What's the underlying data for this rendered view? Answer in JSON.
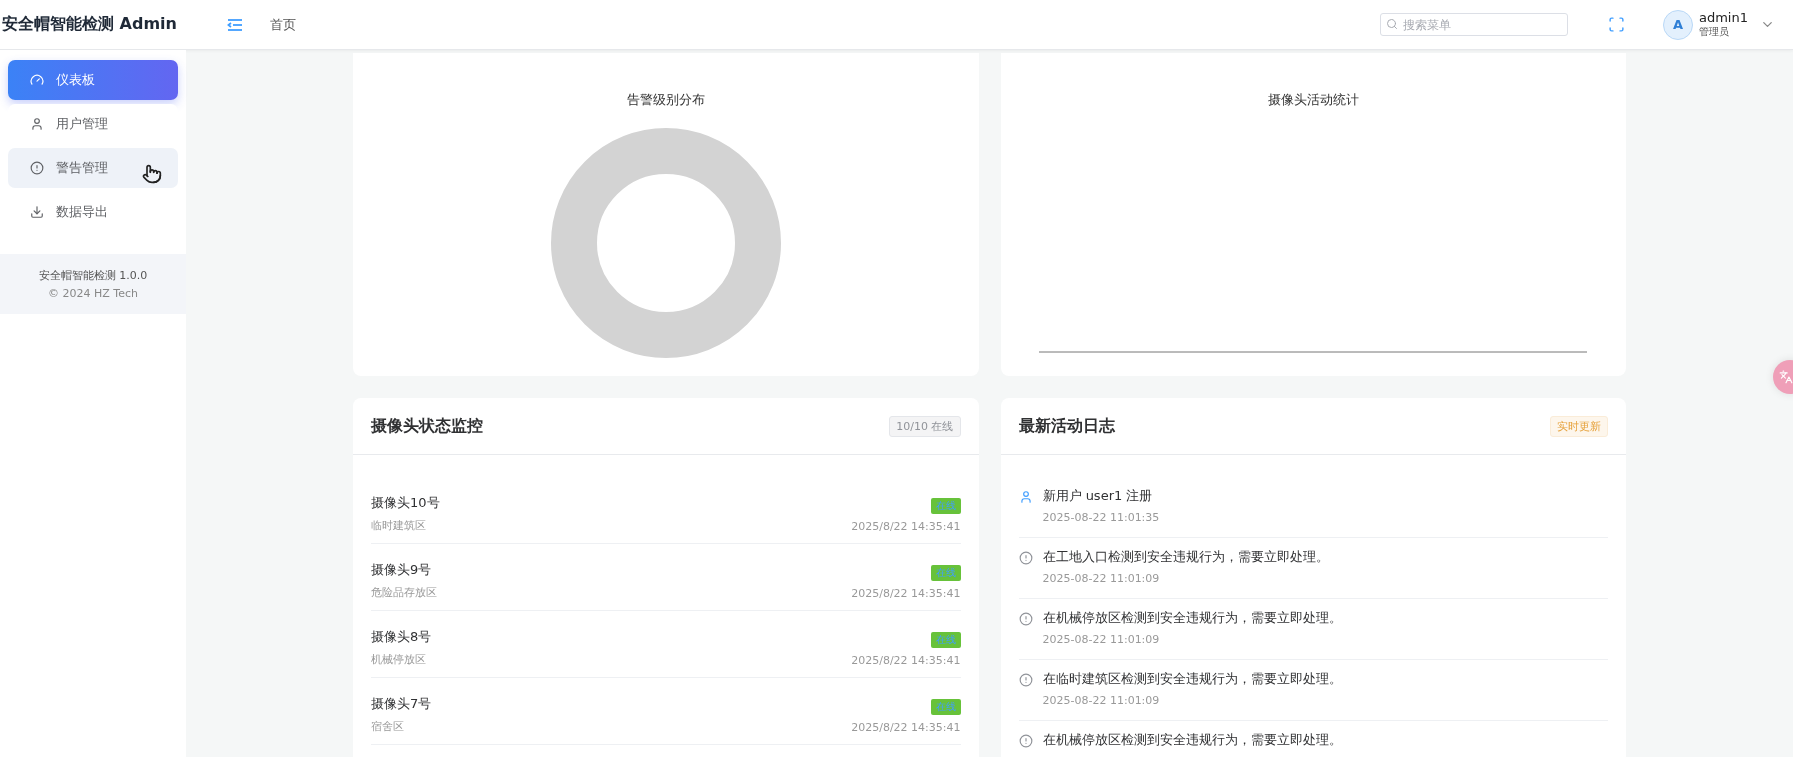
{
  "header": {
    "title": "安全帽智能检测 Admin",
    "breadcrumb": "首页",
    "search": {
      "placeholder": "搜索菜单"
    },
    "user": {
      "avatar": "A",
      "name": "admin1",
      "role": "管理员"
    }
  },
  "sidebar": {
    "items": [
      {
        "label": "仪表板",
        "selected": true,
        "hovered": false
      },
      {
        "label": "用户管理",
        "selected": false,
        "hovered": false
      },
      {
        "label": "警告管理",
        "selected": false,
        "hovered": true
      },
      {
        "label": "数据导出",
        "selected": false,
        "hovered": false
      }
    ],
    "footer": {
      "version": "安全帽智能检测 1.0.0",
      "copyright": "© 2024 HZ Tech"
    }
  },
  "charts": [
    {
      "title": "告警级别分布",
      "kind": "donut"
    },
    {
      "title": "摄像头活动统计",
      "kind": "line"
    }
  ],
  "camera_panel": {
    "title": "摄像头状态监控",
    "badge": "10/10 在线",
    "cameras": [
      {
        "name": "摄像头10号",
        "location": "临时建筑区",
        "status": "在线",
        "online": true,
        "time": "2025/8/22 14:35:41"
      },
      {
        "name": "摄像头9号",
        "location": "危险品存放区",
        "status": "在线",
        "online": true,
        "time": "2025/8/22 14:35:41"
      },
      {
        "name": "摄像头8号",
        "location": "机械停放区",
        "status": "在线",
        "online": true,
        "time": "2025/8/22 14:35:41"
      },
      {
        "name": "摄像头7号",
        "location": "宿舍区",
        "status": "在线",
        "online": true,
        "time": "2025/8/22 14:35:41"
      }
    ]
  },
  "activity_panel": {
    "title": "最新活动日志",
    "badge": "实时更新",
    "entries": [
      {
        "kind": "user",
        "text": "新用户 user1 注册",
        "time": "2025-08-22 11:01:35"
      },
      {
        "kind": "warning",
        "text": "在工地入口检测到安全违规行为，需要立即处理。",
        "time": "2025-08-22 11:01:09"
      },
      {
        "kind": "warning",
        "text": "在机械停放区检测到安全违规行为，需要立即处理。",
        "time": "2025-08-22 11:01:09"
      },
      {
        "kind": "warning",
        "text": "在临时建筑区检测到安全违规行为，需要立即处理。",
        "time": "2025-08-22 11:01:09"
      },
      {
        "kind": "warning",
        "text": "在机械停放区检测到安全违规行为，需要立即处理。"
      }
    ]
  }
}
